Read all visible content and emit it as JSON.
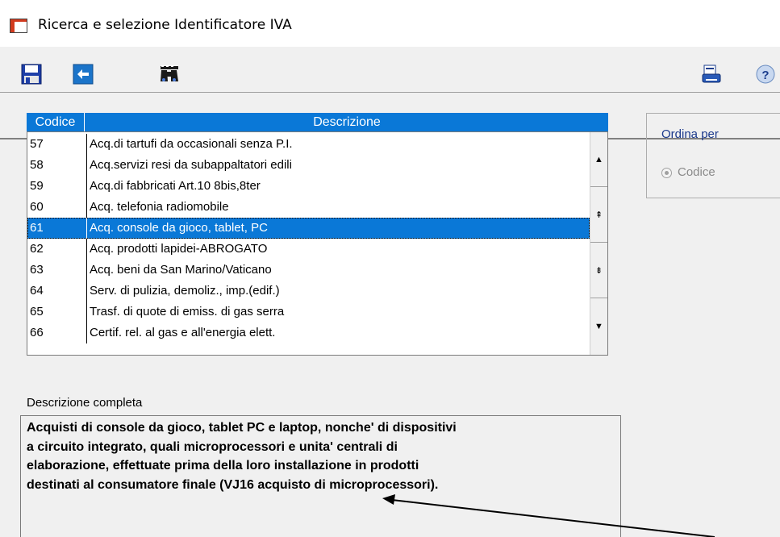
{
  "window": {
    "title": "Ricerca e selezione Identificatore IVA"
  },
  "toolbar": {
    "left_icons": [
      "floppy-save-icon",
      "back-arrow-icon",
      "binoculars-icon"
    ],
    "right_icons": [
      "print-icon",
      "help-icon"
    ]
  },
  "list": {
    "headers": {
      "code": "Codice",
      "description": "Descrizione"
    },
    "rows": [
      {
        "code": "57",
        "description": "Acq.di tartufi da occasionali senza P.I."
      },
      {
        "code": "58",
        "description": "Acq.servizi resi da subappaltatori edili"
      },
      {
        "code": "59",
        "description": "Acq.di fabbricati Art.10 8bis,8ter"
      },
      {
        "code": "60",
        "description": "Acq. telefonia radiomobile"
      },
      {
        "code": "61",
        "description": "Acq. console da gioco, tablet, PC"
      },
      {
        "code": "62",
        "description": "Acq. prodotti lapidei-ABROGATO"
      },
      {
        "code": "63",
        "description": "Acq. beni da San Marino/Vaticano"
      },
      {
        "code": "64",
        "description": "Serv. di pulizia, demoliz., imp.(edif.)"
      },
      {
        "code": "65",
        "description": "Trasf. di quote di emiss. di gas serra"
      },
      {
        "code": "66",
        "description": "Certif. rel. al gas e all'energia elett."
      }
    ],
    "selected_code": "61"
  },
  "order": {
    "title": "Ordina per",
    "option": "Codice"
  },
  "full_description": {
    "label": "Descrizione completa",
    "text": "Acquisti di console da gioco, tablet PC e laptop, nonche' di dispositivi\na circuito integrato, quali microprocessori e unita' centrali di\nelaborazione, effettuate prima della loro installazione in prodotti\ndestinati al consumatore finale  (VJ16 acquisto di microprocessori)."
  },
  "colors": {
    "selection": "#0a78d7",
    "header": "#0a78d7",
    "annotation_arrow": "#000000"
  }
}
